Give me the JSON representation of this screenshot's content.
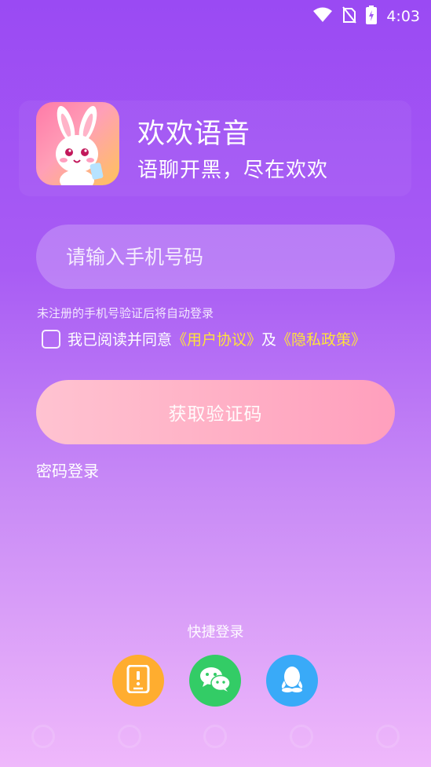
{
  "status_bar": {
    "time": "4:03"
  },
  "app": {
    "name": "欢欢语音",
    "slogan": "语聊开黑，尽在欢欢"
  },
  "phone": {
    "placeholder": "请输入手机号码",
    "value": ""
  },
  "hint": "未注册的手机号验证后将自动登录",
  "agreement": {
    "prefix": "我已阅读并同意",
    "user_agreement": "《用户协议》",
    "and": "及",
    "privacy_policy": "《隐私政策》",
    "checked": false
  },
  "get_code_label": "获取验证码",
  "password_login_label": "密码登录",
  "quick_login": {
    "title": "快捷登录",
    "options": [
      "phone-icon",
      "wechat-icon",
      "qq-icon"
    ]
  },
  "colors": {
    "gradient_top": "#9a4af3",
    "gradient_bottom": "#efb8fb",
    "link": "#ffe23a",
    "phone_button": "#ffad2f",
    "wechat_button": "#33cc66",
    "qq_button": "#39aaf8"
  }
}
